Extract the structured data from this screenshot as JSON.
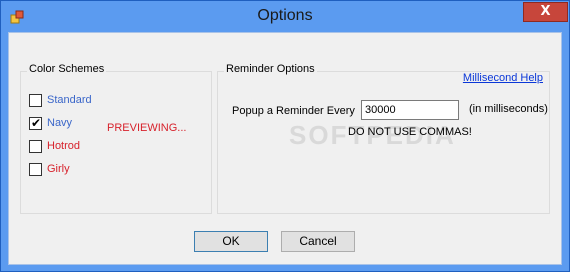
{
  "window": {
    "title": "Options"
  },
  "titlebar": {
    "close_glyph": "X",
    "app_icon": "app-icon"
  },
  "color_schemes": {
    "legend": "Color Schemes",
    "items": [
      {
        "label": "Standard",
        "checked": false,
        "color": "#3a66c9"
      },
      {
        "label": "Navy",
        "checked": true,
        "color": "#3a66c9"
      },
      {
        "label": "Hotrod",
        "checked": false,
        "color": "#d7222c"
      },
      {
        "label": "Girly",
        "checked": false,
        "color": "#d7222c"
      }
    ],
    "preview_status": "PREVIEWING..."
  },
  "reminder": {
    "legend": "Reminder Options",
    "help_link": "Millisecond Help",
    "popup_label": "Popup a Reminder Every",
    "interval_value": "30000",
    "unit_label": "(in milliseconds)",
    "warning": "DO NOT USE COMMAS!"
  },
  "buttons": {
    "ok": "OK",
    "cancel": "Cancel"
  },
  "watermark": "SOFTPEDIA"
}
